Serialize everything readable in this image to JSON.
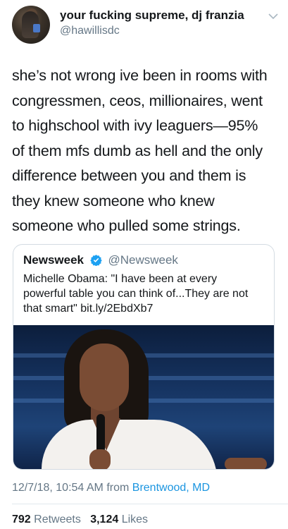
{
  "author": {
    "display_name": "your fucking supreme, dj franzia",
    "handle": "@hawillisdc",
    "avatar_icon": "user-avatar"
  },
  "tweet": {
    "lines": [
      "she’s not wrong ive been in rooms with",
      "congressmen, ceos, millionaires, went",
      "to highschool with ivy leaguers—95%",
      "of them mfs dumb as hell and the only",
      "difference between you and them is",
      "they knew someone who knew",
      "someone who pulled some strings."
    ]
  },
  "quoted": {
    "name": "Newsweek",
    "handle": "@Newsweek",
    "verified_icon": "verified-badge-icon",
    "lines": [
      "Michelle Obama: \"I have been at every",
      "powerful table you can think of...They are not",
      "that smart\" bit.ly/2EbdXb7"
    ]
  },
  "meta": {
    "timestamp": "12/7/18, 10:54 AM from",
    "location": "Brentwood, MD"
  },
  "stats": {
    "retweets_count": "792",
    "retweets_label": "Retweets",
    "likes_count": "3,124",
    "likes_label": "Likes"
  },
  "colors": {
    "link": "#1b95e0",
    "secondary_text": "#657786",
    "primary_text": "#14171a"
  }
}
